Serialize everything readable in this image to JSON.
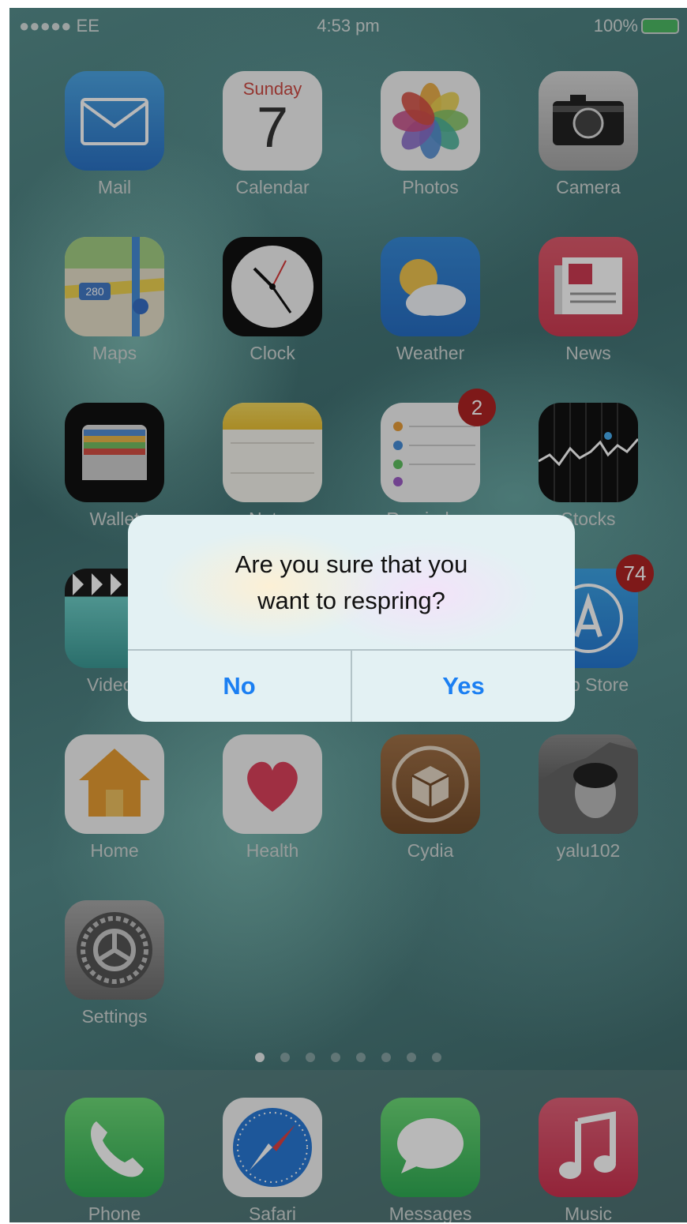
{
  "status_bar": {
    "carrier": "●●●●● EE",
    "wifi_icon": "wifi-icon",
    "time": "4:53 pm",
    "battery": "100%"
  },
  "home": {
    "apps": [
      {
        "label": "Mail",
        "icon": "mail-icon"
      },
      {
        "label": "Calendar",
        "icon": "calendar-icon",
        "day": "Sunday",
        "date": "7"
      },
      {
        "label": "Photos",
        "icon": "photos-icon"
      },
      {
        "label": "Camera",
        "icon": "camera-icon"
      },
      {
        "label": "Maps",
        "icon": "maps-icon",
        "shield": "280"
      },
      {
        "label": "Clock",
        "icon": "clock-icon"
      },
      {
        "label": "Weather",
        "icon": "weather-icon"
      },
      {
        "label": "News",
        "icon": "news-icon"
      },
      {
        "label": "Wallet",
        "icon": "wallet-icon"
      },
      {
        "label": "Notes",
        "icon": "notes-icon"
      },
      {
        "label": "Reminders",
        "icon": "reminders-icon",
        "badge": "2"
      },
      {
        "label": "Stocks",
        "icon": "stocks-icon"
      },
      {
        "label": "Videos",
        "icon": "videos-icon"
      },
      {
        "label": "",
        "icon": "hidden-icon"
      },
      {
        "label": "",
        "icon": "hidden-icon"
      },
      {
        "label": "App Store",
        "icon": "appstore-icon",
        "badge": "74"
      },
      {
        "label": "Home",
        "icon": "home-icon"
      },
      {
        "label": "Health",
        "icon": "health-icon"
      },
      {
        "label": "Cydia",
        "icon": "cydia-icon"
      },
      {
        "label": "yalu102",
        "icon": "yalu102-icon"
      },
      {
        "label": "Settings",
        "icon": "settings-icon"
      }
    ],
    "page_count": 8,
    "current_page": 1
  },
  "dock": [
    {
      "label": "Phone",
      "icon": "phone-icon"
    },
    {
      "label": "Safari",
      "icon": "safari-icon"
    },
    {
      "label": "Messages",
      "icon": "messages-icon"
    },
    {
      "label": "Music",
      "icon": "music-icon"
    }
  ],
  "alert": {
    "message_line1": "Are you sure that you",
    "message_line2": "want to respring?",
    "no_label": "No",
    "yes_label": "Yes",
    "button_color": "#1b7ff2"
  }
}
